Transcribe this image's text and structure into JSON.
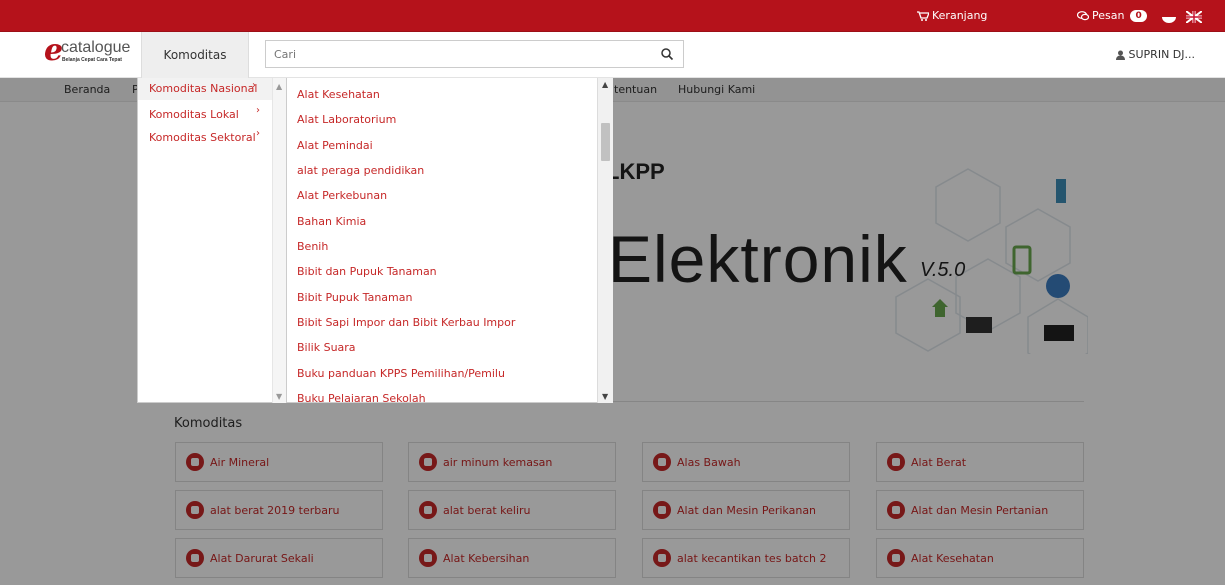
{
  "topbar": {
    "cart_label": "Keranjang",
    "messages_label": "Pesan",
    "messages_count": "0"
  },
  "header": {
    "logo_name": "catalogue",
    "logo_tagline": "Belanja Cepat Cara Tepat",
    "komoditas_tab": "Komoditas",
    "search_placeholder": "Cari",
    "user_name": "SUPRIN DJ..."
  },
  "nav": {
    "items": [
      "Beranda",
      "P",
      "tentuan",
      "Hubungi Kami"
    ]
  },
  "dropdown": {
    "categories": [
      {
        "label": "Komoditas Nasional",
        "active": true
      },
      {
        "label": "Komoditas Lokal",
        "active": false
      },
      {
        "label": "Komoditas Sektoral",
        "active": false
      }
    ],
    "subcategories": [
      "Alat Kesehatan",
      "Alat Laboratorium",
      "Alat Pemindai",
      "alat peraga pendidikan",
      "Alat Perkebunan",
      "Bahan Kimia",
      "Benih",
      "Bibit dan Pupuk Tanaman",
      "Bibit Pupuk Tanaman",
      "Bibit Sapi Impor dan Bibit Kerbau Impor",
      "Bilik Suara",
      "Buku panduan KPPS Pemilihan/Pemilu",
      "Buku Pelajaran Sekolah"
    ]
  },
  "banner": {
    "org": "LKPP",
    "word": "Elektronik",
    "version": "V.5.0"
  },
  "komoditas": {
    "title": "Komoditas",
    "items": [
      "Air Mineral",
      "air minum kemasan",
      "Alas Bawah",
      "Alat Berat",
      "alat berat 2019 terbaru",
      "alat berat keliru",
      "Alat dan Mesin Perikanan",
      "Alat dan Mesin Pertanian",
      "Alat Darurat Sekali",
      "Alat Kebersihan",
      "alat kecantikan tes batch 2",
      "Alat Kesehatan"
    ]
  },
  "colors": {
    "brand_red": "#b5121b",
    "link_red": "#c62828"
  }
}
